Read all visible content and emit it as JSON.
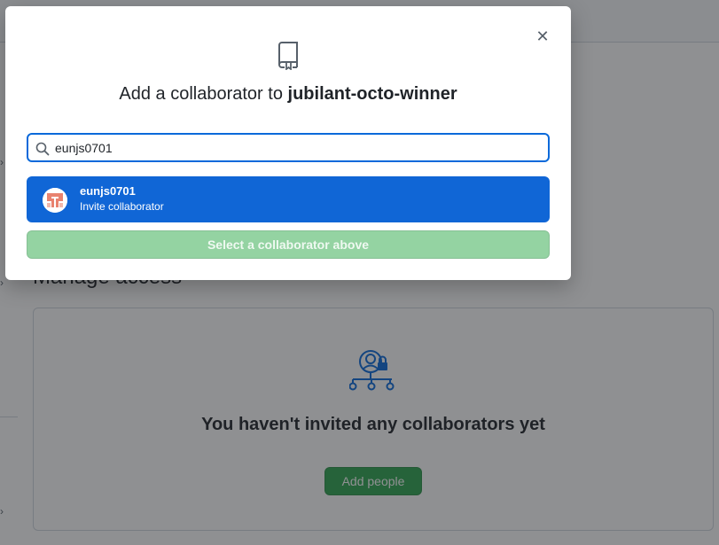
{
  "background": {
    "section_title": "Manage access",
    "empty_state_text": "You haven't invited any collaborators yet",
    "add_people_label": "Add people",
    "rail_chevron": "›"
  },
  "dialog": {
    "close_glyph": "✕",
    "title_prefix": "Add a collaborator to ",
    "repo_name": "jubilant-octo-winner",
    "search": {
      "value": "eunjs0701"
    },
    "suggestion": {
      "username": "eunjs0701",
      "action": "Invite collaborator"
    },
    "submit_label": "Select a collaborator above"
  },
  "colors": {
    "accent_blue": "#1066d6",
    "focus_blue": "#0969da",
    "disabled_green": "#94d3a2",
    "primary_green": "#2da44e"
  },
  "icons": [
    "repo-icon",
    "search-icon",
    "close-icon",
    "people-org-lock-icon",
    "avatar-identicon"
  ]
}
